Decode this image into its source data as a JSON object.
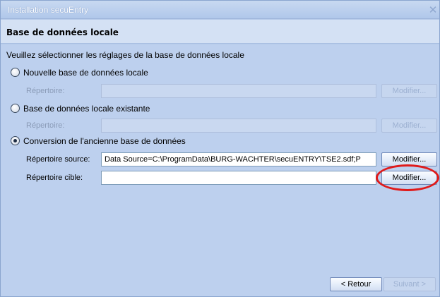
{
  "window": {
    "title": "Installation secuEntry",
    "close_symbol": "✕"
  },
  "header": {
    "title": "Base de données locale"
  },
  "main": {
    "subtitle": "Veuillez sélectionner les réglages de la base de données locale",
    "options": [
      {
        "label": "Nouvelle base de données locale",
        "selected": false,
        "field_label": "Répertoire:",
        "field_value": "",
        "button_label": "Modifier...",
        "enabled": false
      },
      {
        "label": "Base de données locale existante",
        "selected": false,
        "field_label": "Répertoire:",
        "field_value": "",
        "button_label": "Modifier...",
        "enabled": false
      },
      {
        "label": "Conversion de l'ancienne base de données",
        "selected": true,
        "source_label": "Répertoire source:",
        "source_value": "Data Source=C:\\ProgramData\\BURG-WACHTER\\secuENTRY\\TSE2.sdf;P",
        "source_button": "Modifier...",
        "target_label": "Répertoire cible:",
        "target_value": "",
        "target_button": "Modifier..."
      }
    ]
  },
  "footer": {
    "back_label": "< Retour",
    "next_label": "Suivant >"
  },
  "colors": {
    "highlight": "#e01a1a",
    "background": "#bdd0ee"
  }
}
